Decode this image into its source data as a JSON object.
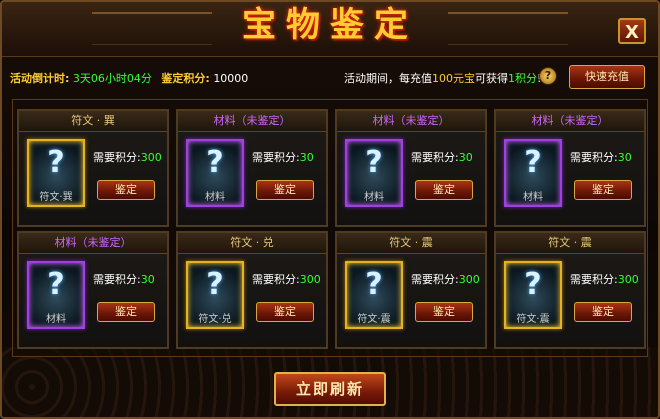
{
  "title": "宝物鉴定",
  "close_label": "X",
  "countdown": {
    "label": "活动倒计时:",
    "value": "3天06小时04分"
  },
  "points": {
    "label": "鉴定积分:",
    "value": "10000"
  },
  "promo": {
    "prefix": "活动期间，每充值",
    "amount": "100元宝",
    "middle": "可获得",
    "points": "1积分",
    "suffix": "!"
  },
  "help_label": "?",
  "recharge_label": "快速充值",
  "cards": [
    {
      "title": "符文 · 巽",
      "title_color": "#e8c87a",
      "frame": "gold",
      "sub": "符文·巽",
      "req_label": "需要积分:",
      "req_value": "300",
      "button": "鉴定"
    },
    {
      "title": "材料（未鉴定）",
      "title_color": "#cc66ff",
      "frame": "purple",
      "sub": "材料",
      "req_label": "需要积分:",
      "req_value": "30",
      "button": "鉴定"
    },
    {
      "title": "材料（未鉴定）",
      "title_color": "#cc66ff",
      "frame": "purple",
      "sub": "材料",
      "req_label": "需要积分:",
      "req_value": "30",
      "button": "鉴定"
    },
    {
      "title": "材料（未鉴定）",
      "title_color": "#cc66ff",
      "frame": "purple",
      "sub": "材料",
      "req_label": "需要积分:",
      "req_value": "30",
      "button": "鉴定"
    },
    {
      "title": "材料（未鉴定）",
      "title_color": "#cc66ff",
      "frame": "purple",
      "sub": "材料",
      "req_label": "需要积分:",
      "req_value": "30",
      "button": "鉴定"
    },
    {
      "title": "符文 · 兑",
      "title_color": "#e8c87a",
      "frame": "gold",
      "sub": "符文·兑",
      "req_label": "需要积分:",
      "req_value": "300",
      "button": "鉴定"
    },
    {
      "title": "符文 · 震",
      "title_color": "#e8c87a",
      "frame": "gold",
      "sub": "符文·震",
      "req_label": "需要积分:",
      "req_value": "300",
      "button": "鉴定"
    },
    {
      "title": "符文 · 震",
      "title_color": "#e8c87a",
      "frame": "gold",
      "sub": "符文·震",
      "req_label": "需要积分:",
      "req_value": "300",
      "button": "鉴定"
    }
  ],
  "refresh_label": "立即刷新"
}
